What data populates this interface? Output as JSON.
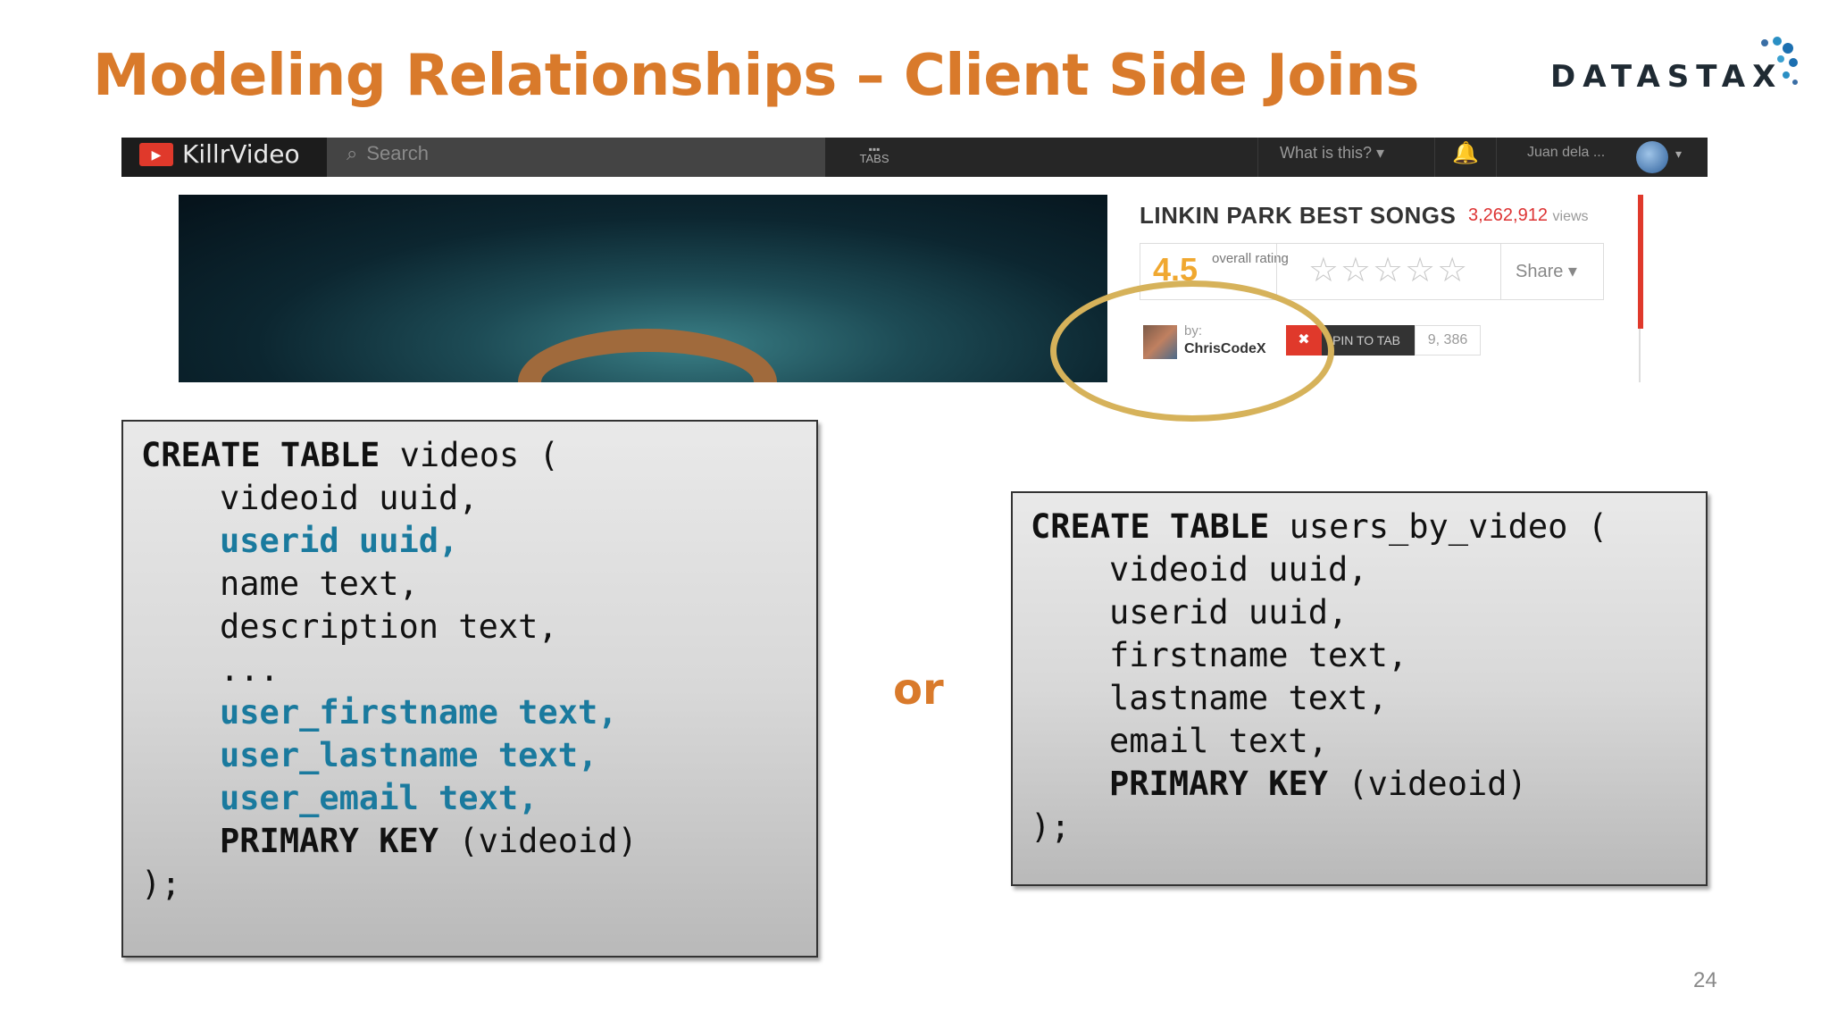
{
  "slide": {
    "title": "Modeling Relationships – Client Side Joins",
    "logo_text": "DATASTAX",
    "or_label": "or",
    "page_number": "24"
  },
  "app": {
    "nav": {
      "logo_icon": "play-icon",
      "logo_text": "KillrVideo",
      "search_placeholder": "Search",
      "tabs_label": "TABS",
      "what_is_this": "What is this? ▾",
      "user_name": "Juan dela ...",
      "bell_icon": "bell-icon"
    },
    "video": {
      "title": "LINKIN PARK BEST SONGS",
      "views_count": "3,262,912",
      "views_unit": "views",
      "rating_value": "4.5",
      "rating_label": "overall rating",
      "stars": "☆☆☆☆☆",
      "share_label": "Share ▾",
      "author_by": "by:",
      "author_name": "ChrisCodeX",
      "pin_label": "PIN TO TAB",
      "pin_count": "9, 386"
    }
  },
  "code_left": {
    "line1_kw": "CREATE TABLE",
    "line1_rest": " videos (",
    "line2": "videoid uuid,",
    "line3": "userid uuid,",
    "line4": "name text,",
    "line5": "description text,",
    "line6": "...",
    "line7": "user_firstname text,",
    "line8": "user_lastname text,",
    "line9": "user_email text,",
    "line10_kw": "PRIMARY KEY",
    "line10_rest": " (videoid)",
    "line11": ");"
  },
  "code_right": {
    "line1_kw": "CREATE TABLE",
    "line1_rest": " users_by_video (",
    "line2": "videoid uuid,",
    "line3": "userid uuid,",
    "line4": "firstname text,",
    "line5": "lastname text,",
    "line6": "email text,",
    "line7_kw": "PRIMARY KEY",
    "line7_rest": " (videoid)",
    "line8": ");"
  },
  "colors": {
    "title": "#d97a2b",
    "highlight_code": "#1a7a9e",
    "circle": "#d6b25a",
    "brand_red": "#e0392b"
  }
}
